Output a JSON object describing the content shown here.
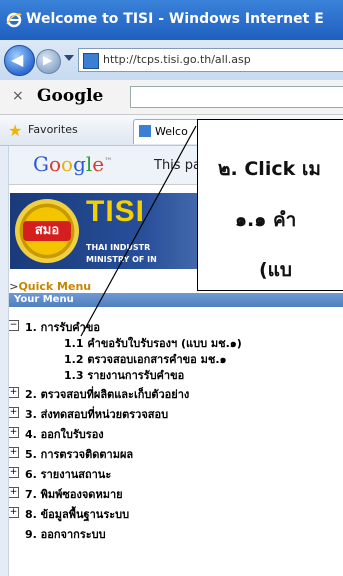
{
  "window": {
    "title": "Welcome to TISI - Windows Internet E"
  },
  "address": {
    "url": "http://tcps.tisi.go.th/all.asp"
  },
  "google_toolbar": {
    "close": "×",
    "logo": "Google"
  },
  "favorites": {
    "label": "Favorites",
    "tab_label": "Welco"
  },
  "google_page": {
    "logo": "Google",
    "tm": "™",
    "text": "This pa"
  },
  "banner": {
    "logo_text": "สมอ",
    "title": "TISI",
    "subtitle_1": "THAI INDUSTR",
    "subtitle_2": "MINISTRY OF IN"
  },
  "quick_menu": {
    "prefix": ">>",
    "label": "Quick Menu"
  },
  "your_menu": {
    "label": "Your Menu"
  },
  "menu": {
    "items": [
      {
        "label": "1. การรับคำขอ",
        "expanded": true,
        "box": "−"
      },
      {
        "label": "2. ตรวจสอบที่ผลิตและเก็บตัวอย่าง",
        "box": "+"
      },
      {
        "label": "3. ส่งทดสอบที่หน่วยตรวจสอบ",
        "box": "+"
      },
      {
        "label": "4. ออกใบรับรอง",
        "box": "+"
      },
      {
        "label": "5. การตรวจติดตามผล",
        "box": "+"
      },
      {
        "label": "6. รายงานสถานะ",
        "box": "+"
      },
      {
        "label": "7. พิมพ์ซองจดหมาย",
        "box": "+"
      },
      {
        "label": "8. ข้อมูลพื้นฐานระบบ",
        "box": "+"
      },
      {
        "label": "9. ออกจากระบบ",
        "box": ""
      }
    ],
    "subitems": [
      {
        "label": "1.1 คำขอรับใบรับรองฯ (แบบ มช.๑)"
      },
      {
        "label": "1.2 ตรวจสอบเอกสารคำขอ มช.๑"
      },
      {
        "label": "1.3 รายงานการรับคำขอ"
      }
    ]
  },
  "callout": {
    "line1": "๒. Click เม",
    "line2": "๑.๑ คำ",
    "line3": "(แบ"
  }
}
